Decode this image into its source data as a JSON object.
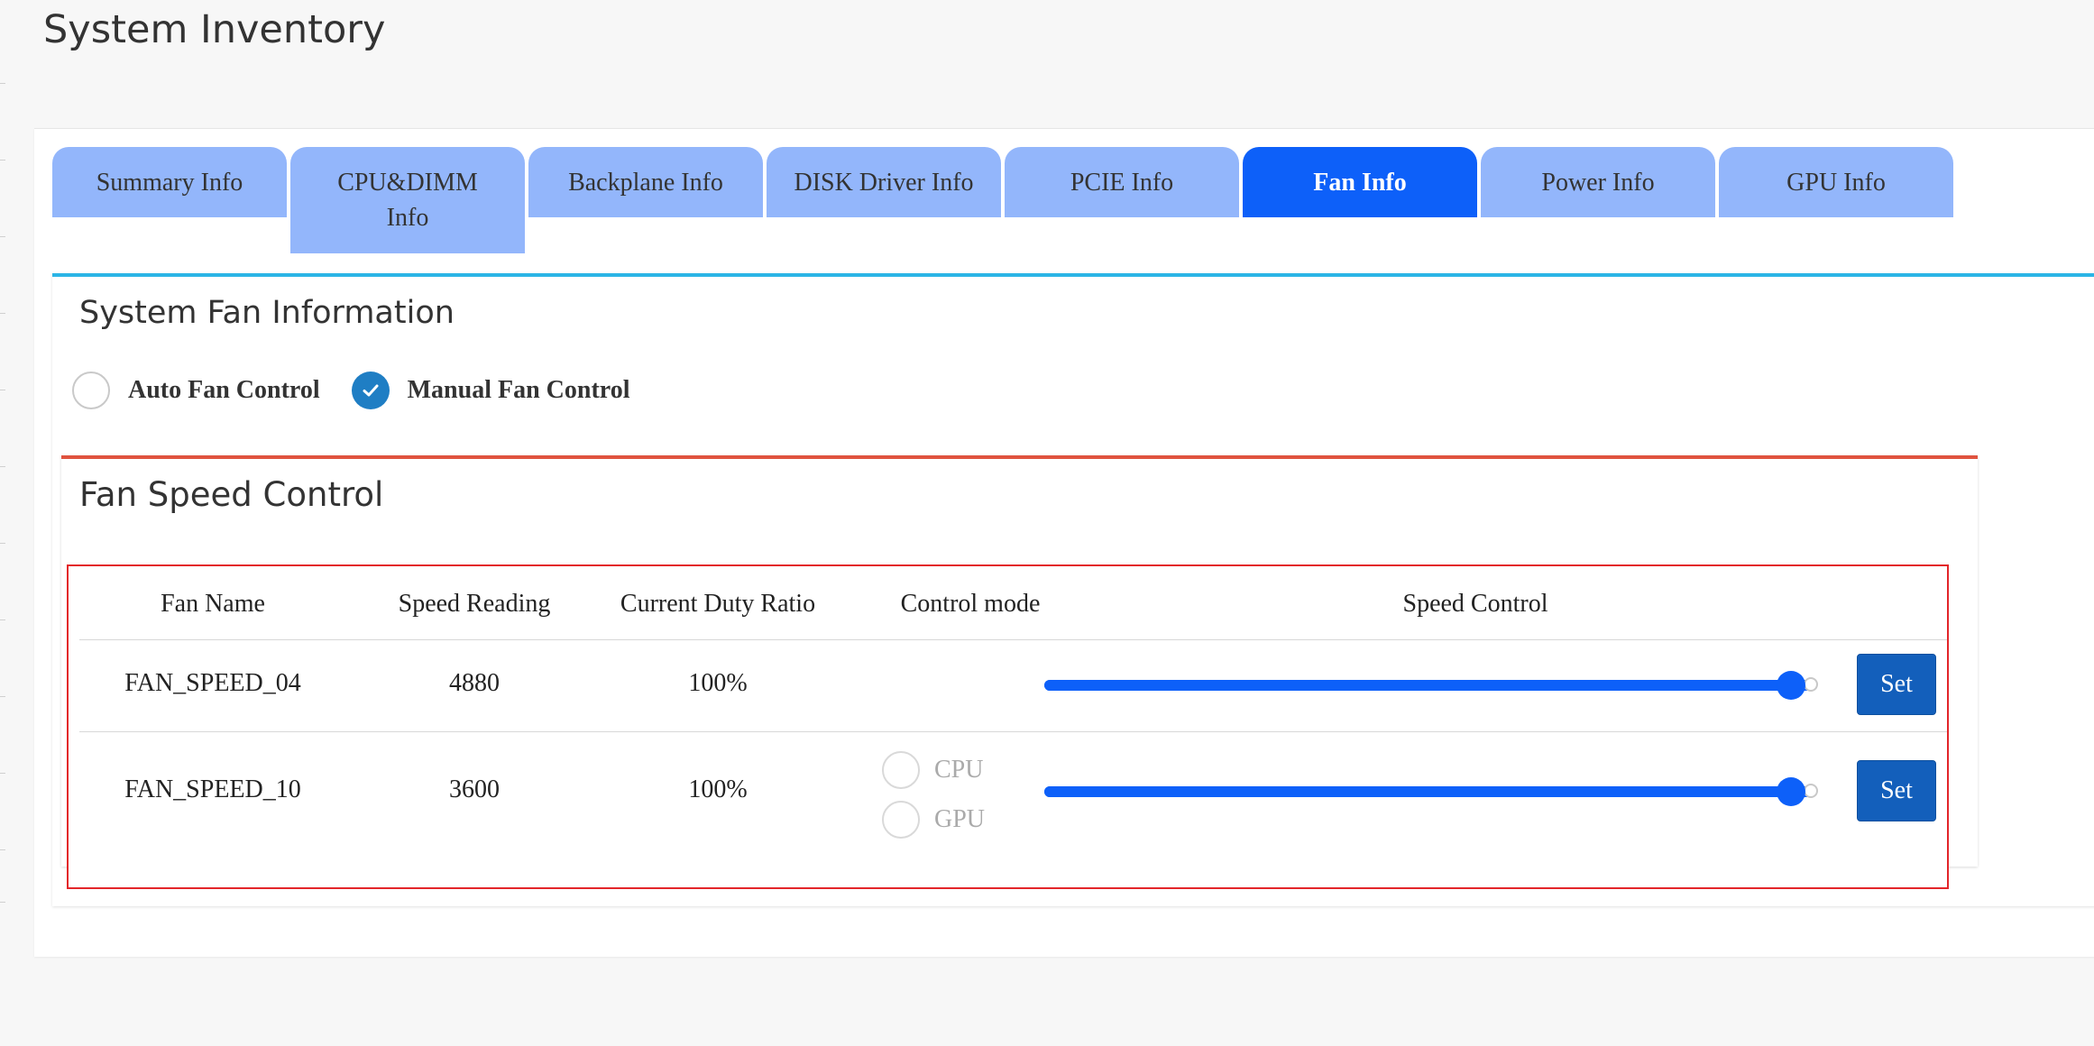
{
  "page": {
    "title": "System Inventory"
  },
  "tabs": [
    {
      "label": "Summary Info"
    },
    {
      "label": "CPU&DIMM Info"
    },
    {
      "label": "Backplane Info"
    },
    {
      "label": "DISK Driver Info"
    },
    {
      "label": "PCIE Info"
    },
    {
      "label": "Fan Info",
      "active": true
    },
    {
      "label": "Power Info"
    },
    {
      "label": "GPU Info"
    }
  ],
  "fan_section": {
    "title": "System Fan Information",
    "modes": [
      {
        "label": "Auto Fan Control",
        "checked": false
      },
      {
        "label": "Manual Fan Control",
        "checked": true
      }
    ]
  },
  "speed_control": {
    "title": "Fan Speed Control",
    "columns": [
      "Fan Name",
      "Speed Reading",
      "Current Duty Ratio",
      "Control mode",
      "Speed Control"
    ],
    "rows": [
      {
        "name": "FAN_SPEED_04",
        "speed": "4880",
        "duty": "100%",
        "control_modes": [],
        "slider_value_percent": 100,
        "set_label": "Set"
      },
      {
        "name": "FAN_SPEED_10",
        "speed": "3600",
        "duty": "100%",
        "control_modes": [
          "CPU",
          "GPU"
        ],
        "slider_value_percent": 100,
        "set_label": "Set"
      }
    ]
  },
  "colors": {
    "tab_inactive": "#93b6fb",
    "tab_active": "#0d60f9",
    "slider": "#0d60f9",
    "set_button": "#135fbb",
    "checked_radio": "#1f7ec4",
    "section_accent": "#2bb5e6",
    "speed_card_accent": "#e0533f",
    "table_border": "#e3262a"
  },
  "icons": {
    "checked": "checkmark-icon"
  }
}
